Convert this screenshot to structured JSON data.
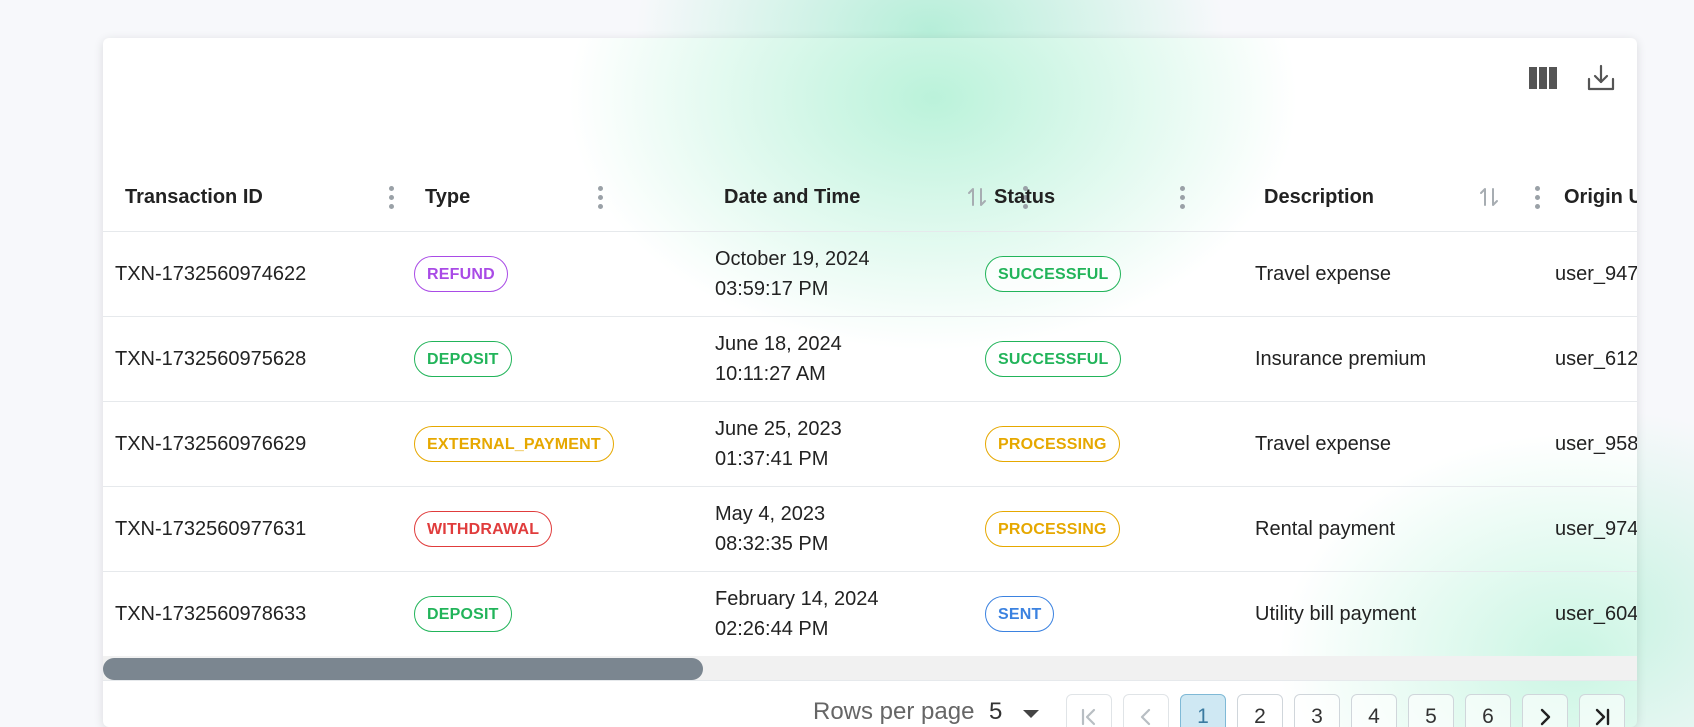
{
  "toolbar": {
    "columns_icon": "view-column-icon",
    "download_icon": "download-icon"
  },
  "table": {
    "columns": [
      {
        "label": "Transaction ID",
        "sortable": false
      },
      {
        "label": "Type",
        "sortable": false
      },
      {
        "label": "Date and Time",
        "sortable": true
      },
      {
        "label": "Status",
        "sortable": false
      },
      {
        "label": "Description",
        "sortable": true
      },
      {
        "label": "Origin U",
        "sortable": false
      }
    ],
    "rows": [
      {
        "id": "TXN-1732560974622",
        "type": "REFUND",
        "date": "October 19, 2024",
        "time": "03:59:17 PM",
        "status": "SUCCESSFUL",
        "description": "Travel expense",
        "origin": "user_947"
      },
      {
        "id": "TXN-1732560975628",
        "type": "DEPOSIT",
        "date": "June 18, 2024",
        "time": "10:11:27 AM",
        "status": "SUCCESSFUL",
        "description": "Insurance premium",
        "origin": "user_612"
      },
      {
        "id": "TXN-1732560976629",
        "type": "EXTERNAL_PAYMENT",
        "date": "June 25, 2023",
        "time": "01:37:41 PM",
        "status": "PROCESSING",
        "description": "Travel expense",
        "origin": "user_958"
      },
      {
        "id": "TXN-1732560977631",
        "type": "WITHDRAWAL",
        "date": "May 4, 2023",
        "time": "08:32:35 PM",
        "status": "PROCESSING",
        "description": "Rental payment",
        "origin": "user_974"
      },
      {
        "id": "TXN-1732560978633",
        "type": "DEPOSIT",
        "date": "February 14, 2024",
        "time": "02:26:44 PM",
        "status": "SENT",
        "description": "Utility bill payment",
        "origin": "user_604"
      }
    ]
  },
  "chip_colors": {
    "REFUND": "#a94be6",
    "DEPOSIT": "#22b45a",
    "EXTERNAL_PAYMENT": "#e6a800",
    "WITHDRAWAL": "#e03c3c",
    "SUCCESSFUL": "#22b45a",
    "PROCESSING": "#e6a800",
    "SENT": "#3b82e0"
  },
  "pagination": {
    "rows_per_page_label": "Rows per page",
    "rows_per_page": "5",
    "first_icon": "first-page-icon",
    "prev_icon": "chevron-left-icon",
    "next_icon": "chevron-right-icon",
    "last_icon": "last-page-icon",
    "pages": [
      "1",
      "2",
      "3",
      "4",
      "5",
      "6"
    ],
    "current_page": "1"
  }
}
